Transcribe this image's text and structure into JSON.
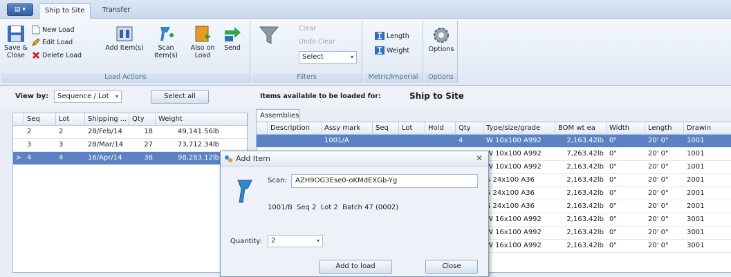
{
  "app": {
    "menu_label": "▤ ▾"
  },
  "tabs": [
    "Ship to Site",
    "Transfer"
  ],
  "ribbon": {
    "save_close": [
      "Save &",
      "Close"
    ],
    "new_load": "New Load",
    "edit_load": "Edit Load",
    "delete_load": "Delete Load",
    "add_items": "Add Item(s)",
    "scan_items": "Scan Item(s)",
    "also_on_load": [
      "Also on",
      "Load"
    ],
    "send": "Send",
    "group_load_actions": "Load Actions",
    "clear": "Clear",
    "undo_clear": "Undo Clear",
    "filter_select": "Select",
    "group_filters": "Filters",
    "length": "Length",
    "weight": "Weight",
    "group_metric": "Metric/Imperial",
    "options": "Options",
    "group_options": "Options"
  },
  "toolbar": {
    "view_by_label": "View by:",
    "view_by_value": "Sequence / Lot",
    "select_all": "Select all",
    "items_available_label": "Items available to be loaded for:",
    "items_available_target": "Ship to Site"
  },
  "left_grid": {
    "columns": [
      "Seq",
      "Lot",
      "Shipping ...",
      "Qty",
      "Weight"
    ],
    "rows": [
      [
        "2",
        "2",
        "28/Feb/14",
        "18",
        "49,141.56lb"
      ],
      [
        "3",
        "3",
        "28/Mar/14",
        "27",
        "73,712.34lb"
      ],
      [
        "4",
        "4",
        "16/Apr/14",
        "36",
        "98,283.12lb"
      ]
    ],
    "selected_row": 2,
    "row_indicator": ">"
  },
  "assemblies": {
    "tab": "Assemblies",
    "columns": [
      "Description",
      "Assy mark",
      "Seq",
      "Lot",
      "Hold",
      "Qty",
      "Type/size/grade",
      "BOM wt ea",
      "Width",
      "Length",
      "Drawin"
    ],
    "first_row_mark": "1001/A",
    "rows": [
      [
        "4",
        "W 10x100 A992",
        "2,163.42lb",
        "0\"",
        "20' 0\"",
        "1001"
      ],
      [
        "4",
        "W 10x100 A992",
        "7,263.42lb",
        "0\"",
        "20' 0\"",
        "1001"
      ],
      [
        "4",
        "W 10x100 A992",
        "2,163.42lb",
        "0\"",
        "20' 0\"",
        "1001"
      ],
      [
        "4",
        "S 24x100 A36",
        "2,163.42lb",
        "0\"",
        "20' 0\"",
        "2001"
      ],
      [
        "4",
        "S 24x100 A36",
        "2,163.42lb",
        "0\"",
        "20' 0\"",
        "2001"
      ],
      [
        "4",
        "S 24x100 A36",
        "2,163.42lb",
        "0\"",
        "20' 0\"",
        "2001"
      ],
      [
        "4",
        "W 16x100 A992",
        "2,163.42lb",
        "0\"",
        "20' 0\"",
        "3001"
      ],
      [
        "4",
        "W 16x100 A992",
        "2,163.42lb",
        "0\"",
        "20' 0\"",
        "3001"
      ],
      [
        "4",
        "W 16x100 A992",
        "2,163.42lb",
        "0\"",
        "20' 0\"",
        "3001"
      ]
    ]
  },
  "dialog": {
    "title": "Add Item",
    "close_glyph": "✕",
    "scan_label": "Scan:",
    "scan_value": "AZH9OG3Ese0-oKMdEXGb-Yg",
    "info": "1001/B  Seq 2  Lot 2  Batch 47 (0002)",
    "quantity_label": "Quantity:",
    "quantity_value": "2",
    "add_button": "Add to load",
    "close_button": "Close"
  }
}
